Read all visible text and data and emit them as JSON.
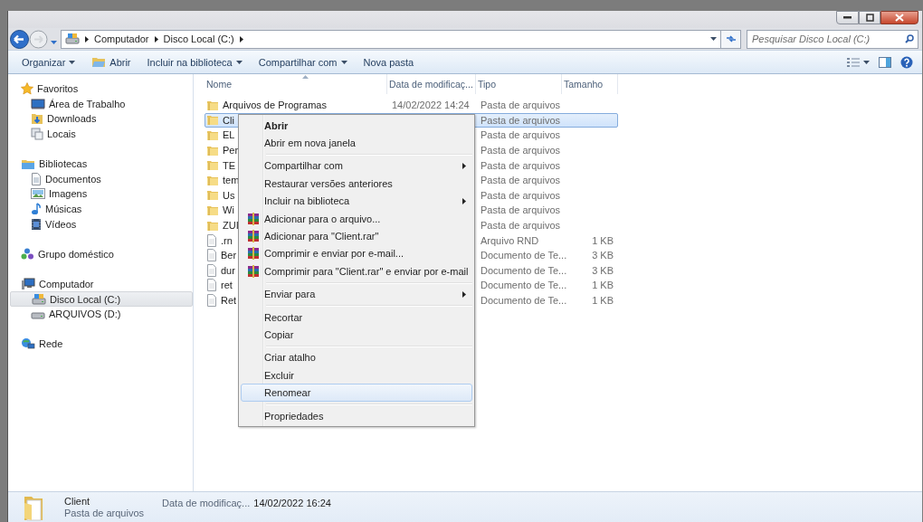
{
  "address_bar": {
    "breadcrumbs": [
      "Computador",
      "Disco Local (C:)"
    ]
  },
  "search": {
    "placeholder": "Pesquisar Disco Local (C:)"
  },
  "toolbar": {
    "items": [
      {
        "label": "Organizar",
        "dropdown": true,
        "has_icon": false
      },
      {
        "label": "Abrir",
        "dropdown": false,
        "has_icon": true
      },
      {
        "label": "Incluir na biblioteca",
        "dropdown": true,
        "has_icon": false
      },
      {
        "label": "Compartilhar com",
        "dropdown": true,
        "has_icon": false
      },
      {
        "label": "Nova pasta",
        "dropdown": false,
        "has_icon": false
      }
    ]
  },
  "navigation": {
    "groups": [
      {
        "label": "Favoritos",
        "selected": false,
        "children": [
          {
            "label": "Área de Trabalho",
            "selected": false
          },
          {
            "label": "Downloads",
            "selected": false
          },
          {
            "label": "Locais",
            "selected": false
          }
        ]
      },
      {
        "label": "Bibliotecas",
        "selected": false,
        "children": [
          {
            "label": "Documentos",
            "selected": false
          },
          {
            "label": "Imagens",
            "selected": false
          },
          {
            "label": "Músicas",
            "selected": false
          },
          {
            "label": "Vídeos",
            "selected": false
          }
        ]
      },
      {
        "label": "Grupo doméstico",
        "selected": false
      },
      {
        "label": "Computador",
        "selected": false,
        "children": [
          {
            "label": "Disco Local (C:)",
            "selected": true
          },
          {
            "label": "ARQUIVOS (D:)",
            "selected": false
          }
        ]
      },
      {
        "label": "Rede",
        "selected": false
      }
    ]
  },
  "file_list": {
    "columns": [
      "Nome",
      "Data de modificaç...",
      "Tipo",
      "Tamanho"
    ],
    "rows": [
      {
        "name": "Arquivos de Programas",
        "date": "14/02/2022 14:24",
        "type": "Pasta de arquivos",
        "kind": "folder",
        "selected": false
      },
      {
        "name": "Cli",
        "type": "Pasta de arquivos",
        "kind": "folder",
        "selected": true
      },
      {
        "name": "EL",
        "type": "Pasta de arquivos",
        "kind": "folder",
        "selected": false
      },
      {
        "name": "Per",
        "type": "Pasta de arquivos",
        "kind": "folder",
        "selected": false
      },
      {
        "name": "TE",
        "type": "Pasta de arquivos",
        "kind": "folder",
        "selected": false
      },
      {
        "name": "tem",
        "type": "Pasta de arquivos",
        "kind": "folder",
        "selected": false
      },
      {
        "name": "Us",
        "type": "Pasta de arquivos",
        "kind": "folder",
        "selected": false
      },
      {
        "name": "Wi",
        "type": "Pasta de arquivos",
        "kind": "folder",
        "selected": false
      },
      {
        "name": "ZUI",
        "type": "Pasta de arquivos",
        "kind": "folder",
        "selected": false
      },
      {
        "name": ".rn",
        "type": "Arquivo RND",
        "size": "1 KB",
        "kind": "file",
        "selected": false
      },
      {
        "name": "Ber",
        "type": "Documento de Te...",
        "size": "3 KB",
        "kind": "file",
        "selected": false
      },
      {
        "name": "dur",
        "type": "Documento de Te...",
        "size": "3 KB",
        "kind": "file",
        "selected": false
      },
      {
        "name": "ret",
        "type": "Documento de Te...",
        "size": "1 KB",
        "kind": "file",
        "selected": false
      },
      {
        "name": "Ret",
        "type": "Documento de Te...",
        "size": "1 KB",
        "kind": "file",
        "selected": false
      }
    ]
  },
  "context_menu": {
    "items": [
      {
        "kind": "item",
        "label": "Abrir",
        "default": true,
        "submenu": false,
        "has_icon": false,
        "selected": false
      },
      {
        "kind": "item",
        "label": "Abrir em nova janela",
        "default": false,
        "submenu": false,
        "has_icon": false,
        "selected": false
      },
      {
        "kind": "separator"
      },
      {
        "kind": "item",
        "label": "Compartilhar com",
        "default": false,
        "submenu": true,
        "has_icon": false,
        "selected": false
      },
      {
        "kind": "item",
        "label": "Restaurar versões anteriores",
        "default": false,
        "submenu": false,
        "has_icon": false,
        "selected": false
      },
      {
        "kind": "item",
        "label": "Incluir na biblioteca",
        "default": false,
        "submenu": true,
        "has_icon": false,
        "selected": false
      },
      {
        "kind": "item",
        "label": "Adicionar para o arquivo...",
        "default": false,
        "submenu": false,
        "has_icon": true,
        "selected": false
      },
      {
        "kind": "item",
        "label": "Adicionar para \"Client.rar\"",
        "default": false,
        "submenu": false,
        "has_icon": true,
        "selected": false
      },
      {
        "kind": "item",
        "label": "Comprimir e enviar por e-mail...",
        "default": false,
        "submenu": false,
        "has_icon": true,
        "selected": false
      },
      {
        "kind": "item",
        "label": "Comprimir para \"Client.rar\" e enviar por e-mail",
        "default": false,
        "submenu": false,
        "has_icon": true,
        "selected": false
      },
      {
        "kind": "separator"
      },
      {
        "kind": "item",
        "label": "Enviar para",
        "default": false,
        "submenu": true,
        "has_icon": false,
        "selected": false
      },
      {
        "kind": "separator"
      },
      {
        "kind": "item",
        "label": "Recortar",
        "default": false,
        "submenu": false,
        "has_icon": false,
        "selected": false
      },
      {
        "kind": "item",
        "label": "Copiar",
        "default": false,
        "submenu": false,
        "has_icon": false,
        "selected": false
      },
      {
        "kind": "separator"
      },
      {
        "kind": "item",
        "label": "Criar atalho",
        "default": false,
        "submenu": false,
        "has_icon": false,
        "selected": false
      },
      {
        "kind": "item",
        "label": "Excluir",
        "default": false,
        "submenu": false,
        "has_icon": false,
        "selected": false
      },
      {
        "kind": "item",
        "label": "Renomear",
        "default": false,
        "submenu": false,
        "has_icon": false,
        "selected": true
      },
      {
        "kind": "separator"
      },
      {
        "kind": "item",
        "label": "Propriedades",
        "default": false,
        "submenu": false,
        "has_icon": false,
        "selected": false
      }
    ]
  },
  "details_pane": {
    "name": "Client",
    "type": "Pasta de arquivos",
    "date_label": "Data de modificaç...",
    "date": "14/02/2022 16:24"
  }
}
